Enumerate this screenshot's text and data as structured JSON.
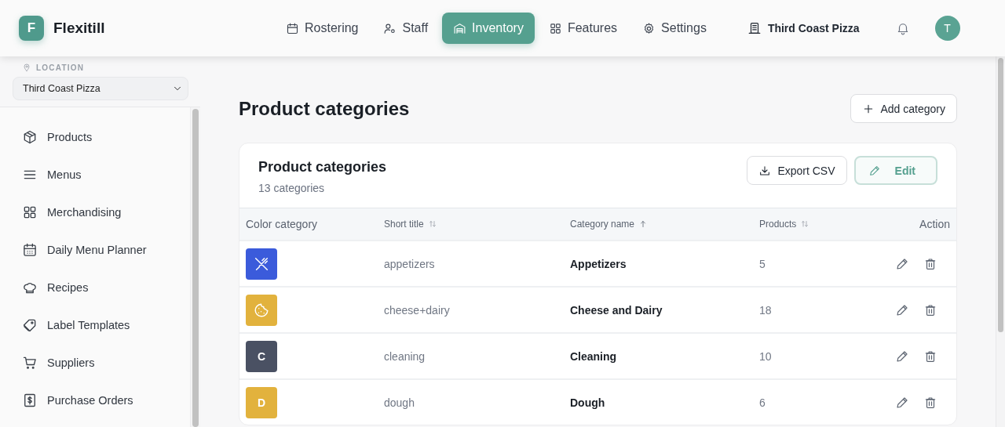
{
  "app": {
    "logo_letter": "F",
    "name": "Flexitill"
  },
  "nav": [
    {
      "label": "Rostering",
      "selected": false
    },
    {
      "label": "Staff",
      "selected": false
    },
    {
      "label": "Inventory",
      "selected": true
    },
    {
      "label": "Features",
      "selected": false
    },
    {
      "label": "Settings",
      "selected": false
    }
  ],
  "header_location": "Third Coast Pizza",
  "avatar_letter": "T",
  "sidebar": {
    "location_label": "LOCATION",
    "location_value": "Third Coast Pizza",
    "items": [
      {
        "label": "Products"
      },
      {
        "label": "Menus"
      },
      {
        "label": "Merchandising"
      },
      {
        "label": "Daily Menu Planner"
      },
      {
        "label": "Recipes"
      },
      {
        "label": "Label Templates"
      },
      {
        "label": "Suppliers"
      },
      {
        "label": "Purchase Orders"
      }
    ]
  },
  "page_title": "Product categories",
  "add_button": "Add category",
  "card": {
    "title": "Product categories",
    "subtitle": "13 categories",
    "export_button": "Export CSV",
    "edit_button": "Edit"
  },
  "table": {
    "columns": [
      {
        "label": "Color category",
        "sortable": false,
        "sorted_ascending": false,
        "kind": "plain"
      },
      {
        "label": "Short title",
        "sortable": true,
        "sorted_ascending": false,
        "kind": "small"
      },
      {
        "label": "Category name",
        "sortable": true,
        "sorted_ascending": true,
        "kind": "small"
      },
      {
        "label": "Products",
        "sortable": true,
        "sorted_ascending": false,
        "kind": "small"
      },
      {
        "label": "Action",
        "sortable": false,
        "sorted_ascending": false,
        "kind": "plain"
      }
    ],
    "rows": [
      {
        "swatch": {
          "kind": "utensils",
          "color": "#3b5bdb"
        },
        "short_title": "appetizers",
        "name": "Appetizers",
        "products": "5"
      },
      {
        "swatch": {
          "kind": "cookie",
          "color": "#e2b23d"
        },
        "short_title": "cheese+dairy",
        "name": "Cheese and Dairy",
        "products": "18"
      },
      {
        "swatch": {
          "kind": "letter",
          "letter": "C",
          "color": "#4a5163"
        },
        "short_title": "cleaning",
        "name": "Cleaning",
        "products": "10"
      },
      {
        "swatch": {
          "kind": "letter",
          "letter": "D",
          "color": "#e2b23d"
        },
        "short_title": "dough",
        "name": "Dough",
        "products": "6"
      }
    ]
  }
}
